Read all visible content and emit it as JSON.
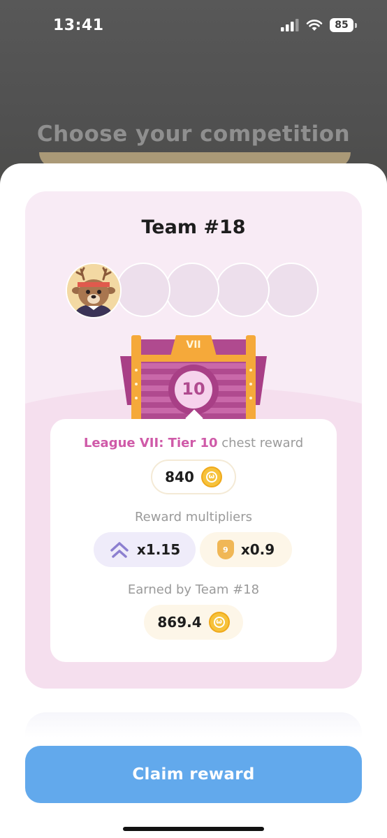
{
  "status_bar": {
    "time": "13:41",
    "battery": "85"
  },
  "page": {
    "heading": "Choose your competition"
  },
  "team_card": {
    "title": "Team #18",
    "chest": {
      "tier_label": "VII",
      "number": "10"
    },
    "reward": {
      "league_label": "League VII: Tier 10",
      "league_suffix": " chest reward",
      "chest_amount": "840",
      "multipliers_label": "Reward multipliers",
      "multiplier_streak": "x1.15",
      "multiplier_rank_badge": "9",
      "multiplier_rank": "x0.9",
      "earned_label": "Earned by Team #18",
      "earned_amount": "869.4"
    }
  },
  "actions": {
    "claim_label": "Claim reward"
  },
  "colors": {
    "accent_pink": "#cf5aa8",
    "button_blue": "#62a9ec",
    "chest_purple": "#b04a8f",
    "coin_gold": "#f6c23b"
  }
}
